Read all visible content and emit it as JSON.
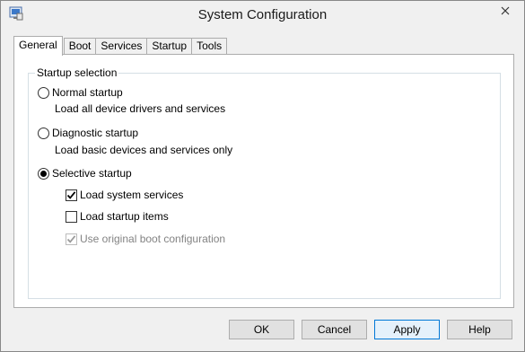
{
  "window": {
    "title": "System Configuration",
    "close_label": "✕"
  },
  "tabs": [
    {
      "label": "General",
      "active": true
    },
    {
      "label": "Boot"
    },
    {
      "label": "Services"
    },
    {
      "label": "Startup"
    },
    {
      "label": "Tools"
    }
  ],
  "startup_selection": {
    "group_label": "Startup selection",
    "normal": {
      "label": "Normal startup",
      "description": "Load all device drivers and services",
      "selected": false
    },
    "diagnostic": {
      "label": "Diagnostic startup",
      "description": "Load basic devices and services only",
      "selected": false
    },
    "selective": {
      "label": "Selective startup",
      "selected": true
    },
    "options": {
      "load_system_services": {
        "label": "Load system services",
        "checked": true,
        "enabled": true
      },
      "load_startup_items": {
        "label": "Load startup items",
        "checked": false,
        "enabled": true
      },
      "use_original_boot_config": {
        "label": "Use original boot configuration",
        "checked": true,
        "enabled": false
      }
    }
  },
  "buttons": {
    "ok": "OK",
    "cancel": "Cancel",
    "apply": "Apply",
    "help": "Help"
  },
  "colors": {
    "focus_border": "#0078d7",
    "window_bg": "#f0f0f0"
  }
}
